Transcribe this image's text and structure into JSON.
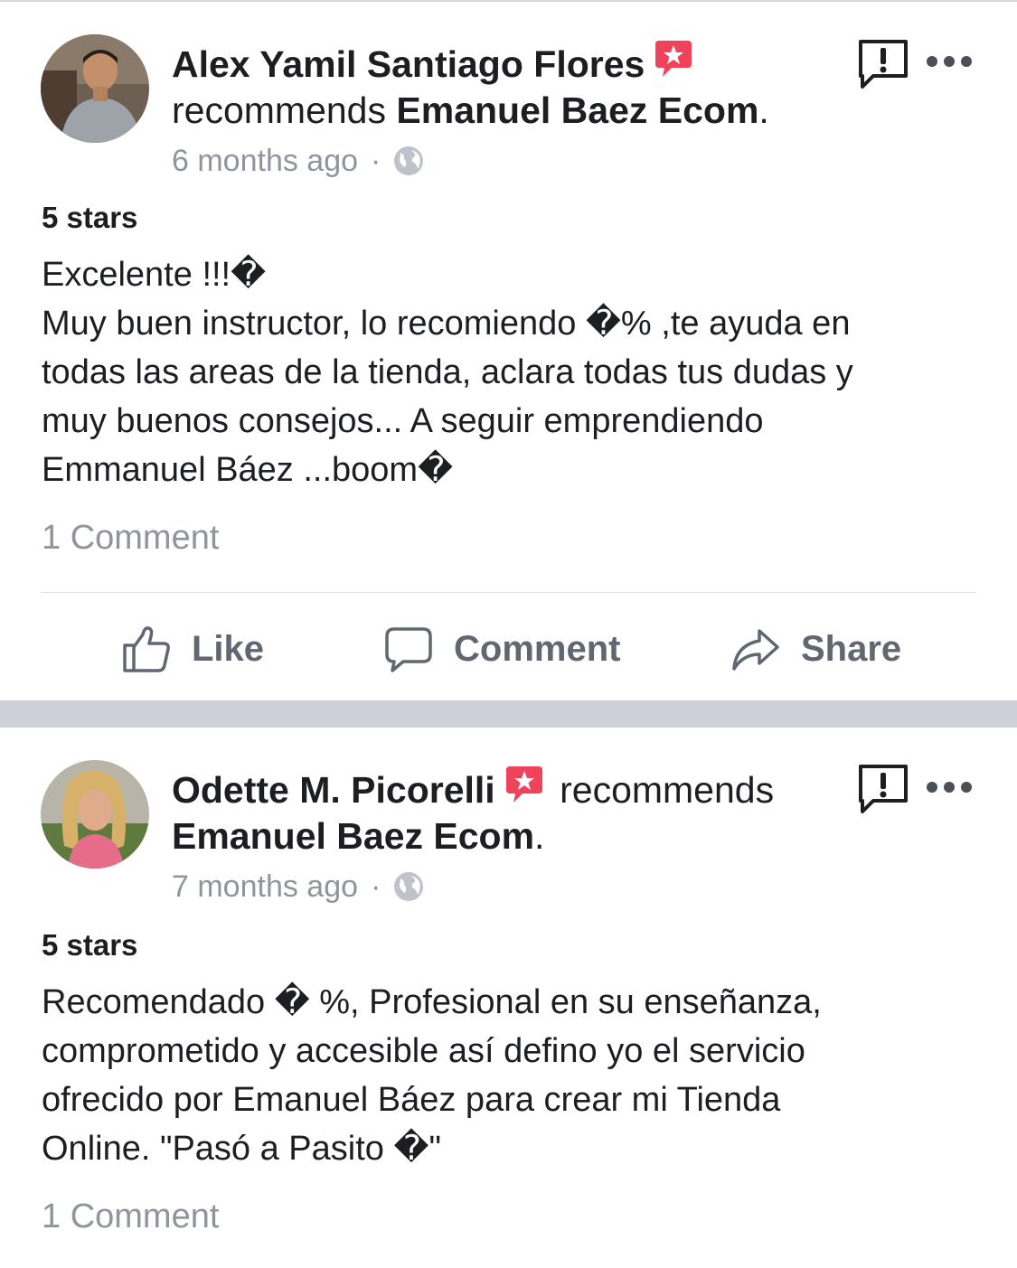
{
  "posts": [
    {
      "author": "Alex Yamil Santiago Flores",
      "verb": "recommends",
      "page": "Emanuel Baez Ecom",
      "period": ".",
      "time": "6 months ago",
      "separator": "·",
      "rating": "5 stars",
      "body_lines": [
        "Excelente !!!�",
        "Muy buen instructor, lo recomiendo �% ,te ayuda en",
        "todas las areas de la tienda, aclara todas tus dudas y",
        "muy buenos consejos... A seguir emprendiendo",
        "Emmanuel Báez ...boom�"
      ],
      "comments": "1 Comment"
    },
    {
      "author": "Odette M. Picorelli",
      "verb": "recommends",
      "page": "Emanuel Baez Ecom",
      "period": ".",
      "time": "7 months ago",
      "separator": "·",
      "rating": "5 stars",
      "body_lines": [
        "Recomendado � %, Profesional en su enseñanza,",
        "comprometido y accesible así defino yo el servicio",
        "ofrecido por Emanuel Báez para crear mi Tienda",
        "Online. \"Pasó a Pasito �\""
      ],
      "comments": "1 Comment"
    }
  ],
  "actions": {
    "like": "Like",
    "comment": "Comment",
    "share": "Share"
  },
  "icons": {
    "recommend_badge": "recommend-star-badge-icon",
    "globe": "globe-icon",
    "report": "report-flag-icon",
    "more": "more-options-icon",
    "like": "thumbs-up-icon",
    "comment": "speech-bubble-icon",
    "share": "share-arrow-icon"
  },
  "colors": {
    "text": "#1c1e21",
    "meta": "#90949c",
    "action": "#606770",
    "badge": "#f0435b",
    "band": "#cdd0d6"
  }
}
